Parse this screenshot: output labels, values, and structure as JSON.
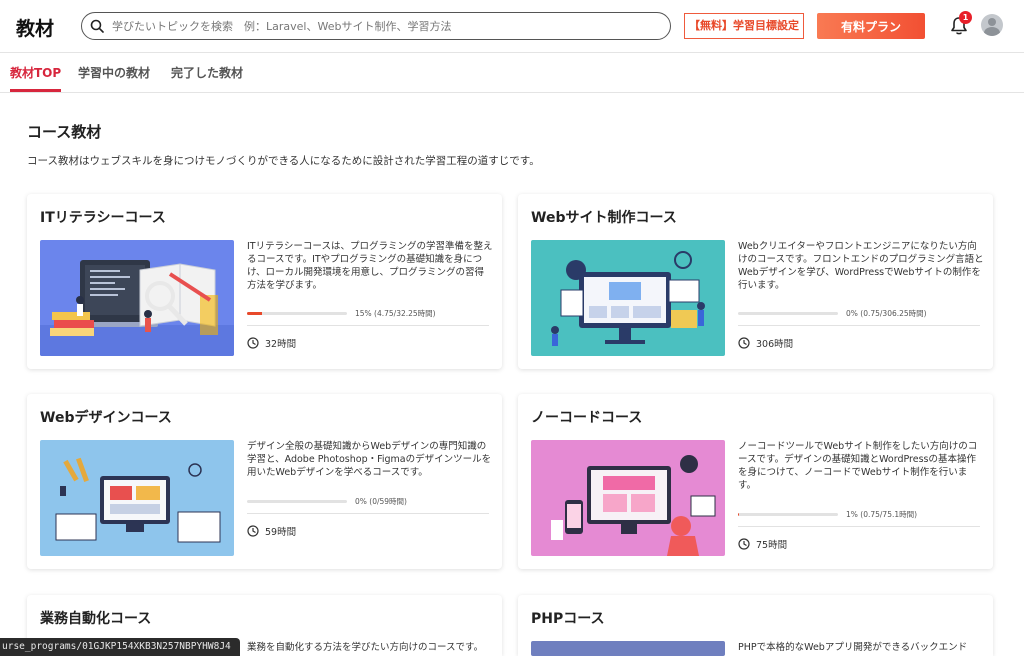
{
  "header": {
    "logo": "教材",
    "search_placeholder": "学びたいトピックを検索　例：Laravel、Webサイト制作、学習方法",
    "goal_button": "【無料】学習目標設定",
    "premium_button": "有料プラン",
    "notification_count": "1"
  },
  "tabs": [
    "教材TOP",
    "学習中の教材",
    "完了した教材"
  ],
  "section": {
    "title": "コース教材",
    "description": "コース教材はウェブスキルを身につけモノづくりができる人になるために設計された学習工程の道すじです。"
  },
  "courses": [
    {
      "title": "ITリテラシーコース",
      "description": "ITリテラシーコースは、プログラミングの学習準備を整えるコースです。ITやプログラミングの基礎知識を身につけ、ローカル開発環境を用意し、プログラミングの習得方法を学びます。",
      "progress_ratio": 0.15,
      "progress_text": "15% (4.75/32.25時間)",
      "duration": "32時間",
      "thumb_color": "#6b85ec"
    },
    {
      "title": "Webサイト制作コース",
      "description": "Webクリエイターやフロントエンジニアになりたい方向けのコースです。フロントエンドのプログラミング言語とWebデザインを学び、WordPressでWebサイトの制作を行います。",
      "progress_ratio": 0,
      "progress_text": "0% (0.75/306.25時間)",
      "duration": "306時間",
      "thumb_color": "#4bc0c0"
    },
    {
      "title": "Webデザインコース",
      "description": "デザイン全般の基礎知識からWebデザインの専門知識の学習と、Adobe Photoshop・Figmaのデザインツールを用いたWebデザインを学べるコースです。",
      "progress_ratio": 0,
      "progress_text": "0% (0/59時間)",
      "duration": "59時間",
      "thumb_color": "#8ec5ec"
    },
    {
      "title": "ノーコードコース",
      "description": "ノーコードツールでWebサイト制作をしたい方向けのコースです。デザインの基礎知識とWordPressの基本操作を身につけて、ノーコードでWebサイト制作を行います。",
      "progress_ratio": 0.01,
      "progress_text": "1% (0.75/75.1時間)",
      "duration": "75時間",
      "thumb_color": "#e58ad3"
    },
    {
      "title": "業務自動化コース",
      "description": "業務を自動化する方法を学びたい方向けのコースです。"
    },
    {
      "title": "PHPコース",
      "description": "PHPで本格的なWebアプリ開発ができるバックエンド"
    }
  ],
  "status_url": "urse_programs/01GJKP154XKB3N257NBPYHW8J4"
}
